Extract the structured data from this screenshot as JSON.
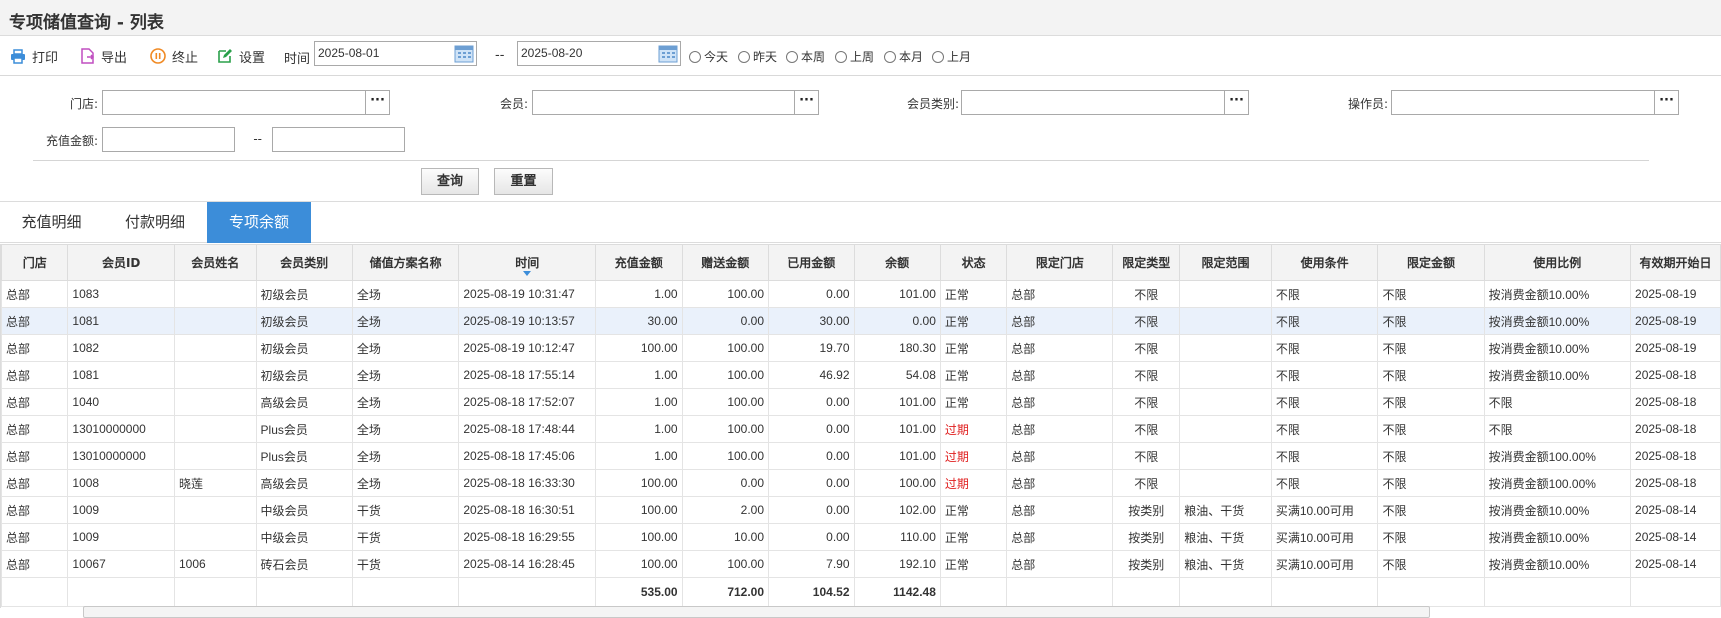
{
  "title": "专项储值查询 - 列表",
  "toolbar": {
    "print": "打印",
    "export": "导出",
    "stop": "终止",
    "settings": "设置",
    "time_label": "时间",
    "date_from": "2025-08-01",
    "date_sep": "--",
    "date_to": "2025-08-20",
    "quick_dates": [
      "今天",
      "昨天",
      "本周",
      "上周",
      "本月",
      "上月"
    ]
  },
  "filters": {
    "store_label": "门店:",
    "member_label": "会员:",
    "member_type_label": "会员类别:",
    "operator_label": "操作员:",
    "amount_label": "充值金额:",
    "amount_sep": "--",
    "dots": "···",
    "query_button": "查询",
    "reset_button": "重置"
  },
  "tabs": [
    "充值明细",
    "付款明细",
    "专项余额"
  ],
  "table": {
    "columns": [
      "门店",
      "会员ID",
      "会员姓名",
      "会员类别",
      "储值方案名称",
      "时间",
      "充值金额",
      "赠送金额",
      "已用金额",
      "余额",
      "状态",
      "限定门店",
      "限定类型",
      "限定范围",
      "使用条件",
      "限定金额",
      "使用比例",
      "有效期开始日"
    ],
    "rows": [
      [
        "总部",
        "1083",
        "",
        "初级会员",
        "全场",
        "2025-08-19 10:31:47",
        "1.00",
        "100.00",
        "0.00",
        "101.00",
        "正常",
        "总部",
        "不限",
        "",
        "不限",
        "不限",
        "按消费金额10.00%",
        "2025-08-19"
      ],
      [
        "总部",
        "1081",
        "",
        "初级会员",
        "全场",
        "2025-08-19 10:13:57",
        "30.00",
        "0.00",
        "30.00",
        "0.00",
        "正常",
        "总部",
        "不限",
        "",
        "不限",
        "不限",
        "按消费金额10.00%",
        "2025-08-19"
      ],
      [
        "总部",
        "1082",
        "",
        "初级会员",
        "全场",
        "2025-08-19 10:12:47",
        "100.00",
        "100.00",
        "19.70",
        "180.30",
        "正常",
        "总部",
        "不限",
        "",
        "不限",
        "不限",
        "按消费金额10.00%",
        "2025-08-19"
      ],
      [
        "总部",
        "1081",
        "",
        "初级会员",
        "全场",
        "2025-08-18 17:55:14",
        "1.00",
        "100.00",
        "46.92",
        "54.08",
        "正常",
        "总部",
        "不限",
        "",
        "不限",
        "不限",
        "按消费金额10.00%",
        "2025-08-18"
      ],
      [
        "总部",
        "1040",
        "",
        "高级会员",
        "全场",
        "2025-08-18 17:52:07",
        "1.00",
        "100.00",
        "0.00",
        "101.00",
        "正常",
        "总部",
        "不限",
        "",
        "不限",
        "不限",
        "不限",
        "2025-08-18"
      ],
      [
        "总部",
        "13010000000",
        "",
        "Plus会员",
        "全场",
        "2025-08-18 17:48:44",
        "1.00",
        "100.00",
        "0.00",
        "101.00",
        "过期",
        "总部",
        "不限",
        "",
        "不限",
        "不限",
        "不限",
        "2025-08-18"
      ],
      [
        "总部",
        "13010000000",
        "",
        "Plus会员",
        "全场",
        "2025-08-18 17:45:06",
        "1.00",
        "100.00",
        "0.00",
        "101.00",
        "过期",
        "总部",
        "不限",
        "",
        "不限",
        "不限",
        "按消费金额100.00%",
        "2025-08-18"
      ],
      [
        "总部",
        "1008",
        "晓莲",
        "高级会员",
        "全场",
        "2025-08-18 16:33:30",
        "100.00",
        "0.00",
        "0.00",
        "100.00",
        "过期",
        "总部",
        "不限",
        "",
        "不限",
        "不限",
        "按消费金额100.00%",
        "2025-08-18"
      ],
      [
        "总部",
        "1009",
        "",
        "中级会员",
        "干货",
        "2025-08-18 16:30:51",
        "100.00",
        "2.00",
        "0.00",
        "102.00",
        "正常",
        "总部",
        "按类别",
        "粮油、干货",
        "买满10.00可用",
        "不限",
        "按消费金额10.00%",
        "2025-08-14"
      ],
      [
        "总部",
        "1009",
        "",
        "中级会员",
        "干货",
        "2025-08-18 16:29:55",
        "100.00",
        "10.00",
        "0.00",
        "110.00",
        "正常",
        "总部",
        "按类别",
        "粮油、干货",
        "买满10.00可用",
        "不限",
        "按消费金额10.00%",
        "2025-08-14"
      ],
      [
        "总部",
        "10067",
        "1006",
        "砖石会员",
        "干货",
        "2025-08-14 16:28:45",
        "100.00",
        "100.00",
        "7.90",
        "192.10",
        "正常",
        "总部",
        "按类别",
        "粮油、干货",
        "买满10.00可用",
        "不限",
        "按消费金额10.00%",
        "2025-08-14"
      ]
    ],
    "totals": [
      "",
      "",
      "",
      "",
      "",
      "",
      "535.00",
      "712.00",
      "104.52",
      "1142.48",
      "",
      "",
      "",
      "",
      "",
      "",
      "",
      ""
    ]
  },
  "colors": {
    "accent": "#3c8dd9",
    "expired": "#e02020",
    "selected_row": "#eaf1fb"
  }
}
